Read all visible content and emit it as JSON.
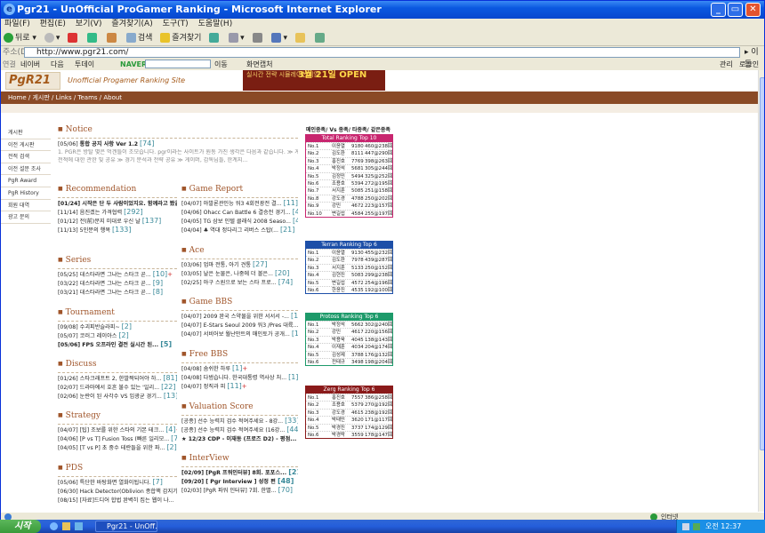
{
  "window": {
    "title": "Pgr21 - UnOfficial ProGamer Ranking - Microsoft Internet Explorer"
  },
  "menu": [
    "파일(F)",
    "편집(E)",
    "보기(V)",
    "즐겨찾기(A)",
    "도구(T)",
    "도움말(H)"
  ],
  "toolbar": {
    "back": "뒤로",
    "search": "검색",
    "favorites": "즐겨찾기"
  },
  "address": {
    "label": "주소(D)",
    "url": "http://www.pgr21.com/",
    "go": "이동"
  },
  "links": {
    "label": "연결",
    "items": [
      "네이버",
      "다음",
      "투데이",
      "NAVER",
      "이동",
      "화면캡처",
      "관리",
      "로그인"
    ]
  },
  "site": {
    "logo": "PgR21",
    "tagline": "Unofficial Progamer Ranking Site",
    "banner_top": "실시간 전략 시뮬레이션게임",
    "banner_main": "3월 21일 OPEN",
    "nav": "Home / 게시판 / Links / Teams / About"
  },
  "sidebar": [
    "게시판",
    "이전 게시판",
    "전적 검색",
    "이전 설문 조사",
    "PgR Award",
    "PgR History",
    "회원 대역",
    "광고 문의"
  ],
  "notice": {
    "title": "Notice",
    "rows": [
      {
        "date": "[05/06]",
        "text": "통합 공지 사항 Ver 1.2",
        "count": "[74]"
      }
    ],
    "desc1": "1. PGR은 방탈 몇은 먹겐틀이 조모습니다. pgr이라는 사이트가 원동 가진 생각은 다음과 같습니다. ≫ 게시마롤의",
    "desc2": "전적에 대한 관한 및 공유 ≫ 경기 분석과 전략 공유 ≫ 게이머, 감독님들, 한계지..."
  },
  "left_sections": [
    {
      "title": "Recommendation",
      "rows": [
        {
          "date": "[01/24]",
          "text": "시작은 단 두 사람이었지요. 함께라고 봤을...",
          "count": "[106]",
          "bold": true
        },
        {
          "date": "[11/14]",
          "text": "음진겠는 가격협력",
          "count": "[292]"
        },
        {
          "date": "[01/12]",
          "text": "전(前)문지 미대로 우신 날",
          "count": "[137]"
        },
        {
          "date": "[11/13]",
          "text": "5인분의 행복",
          "count": "[133]"
        }
      ]
    },
    {
      "title": "Series",
      "rows": [
        {
          "date": "[05/25]",
          "text": "대스타라면 그냐는 스타크 곧...",
          "count": "[10]",
          "plus": true
        },
        {
          "date": "[03/22]",
          "text": "대스타라면 그냐는 스타크 곧...",
          "count": "[9]"
        },
        {
          "date": "[03/21]",
          "text": "대스타라면 그냐는 스타크 곧...",
          "count": "[8]"
        }
      ]
    },
    {
      "title": "Tournament",
      "rows": [
        {
          "date": "[09/08]",
          "text": "수괴피반슬라피~",
          "count": "[2]"
        },
        {
          "date": "[05/07]",
          "text": "코러그 레이아스",
          "count": "[2]"
        },
        {
          "date": "[05/06]",
          "text": "FPS 오프라인 결전 실시간 된...",
          "count": "[5]",
          "bold": true
        }
      ]
    },
    {
      "title": "Discuss",
      "rows": [
        {
          "date": "[01/26]",
          "text": "스타크래프트 2, 한발짝되어야 하...",
          "count": "[81]",
          "plus": true
        },
        {
          "date": "[02/07]",
          "text": "드라마에서 호흔 불수 있는 '일리...",
          "count": "[22]"
        },
        {
          "date": "[02/06]",
          "text": "눈란이 된 사각수 VS 임광균 경기...",
          "count": "[13]"
        }
      ]
    },
    {
      "title": "Strategy",
      "rows": [
        {
          "date": "[04/07]",
          "text": "[팁] 조보를 위한 스타의 기본 테크...",
          "count": "[4]",
          "plus": true
        },
        {
          "date": "[04/06]",
          "text": "[P vs T] Fusion Toss (빠른 일리모...",
          "count": "[7]",
          "plus": true
        },
        {
          "date": "[04/05]",
          "text": "[T vs P] 초 중수 테란들을 위한 파...",
          "count": "[2]"
        }
      ]
    },
    {
      "title": "PDS",
      "rows": [
        {
          "date": "[05/06]",
          "text": "특단한 바탕화면 열화이됩니다.",
          "count": "[7]"
        },
        {
          "date": "[06/30]",
          "text": "Hack Detector(Oblivion 종합핵 감지기...",
          "count": "[17]"
        },
        {
          "date": "[08/15]",
          "text": "[자료]드디어 합법 완벽히 집는 웹이 나...",
          "count": ""
        }
      ]
    }
  ],
  "right_sections": [
    {
      "title": "Game Report",
      "rows": [
        {
          "date": "[04/07]",
          "text": "아발론관인능 워3 4회전광전 결...",
          "count": "[11]",
          "plus": true
        },
        {
          "date": "[04/06]",
          "text": "Ohacc Can Battle 6 결승전 경기...",
          "count": "[4]"
        },
        {
          "date": "[04/05]",
          "text": "TG 삼보 인텔 클래식 2008 Seaso...",
          "count": "[4]"
        },
        {
          "date": "[04/04]",
          "text": "♣ 역대 정다리그 리버스 스탑(...",
          "count": "[21]"
        }
      ]
    },
    {
      "title": "Ace",
      "rows": [
        {
          "date": "[03/06]",
          "text": "업마 전통, 아기 견통",
          "count": "[27]"
        },
        {
          "date": "[03/05]",
          "text": "날은 눈물은, 나중에 더 볼은...",
          "count": "[20]"
        },
        {
          "date": "[02/25]",
          "text": "아구 스원으로 보는 스타 프로...",
          "count": "[74]"
        }
      ]
    },
    {
      "title": "Game BBS",
      "rows": [
        {
          "date": "[04/07]",
          "text": "2009 완국 스약물을 위한 서서서 -...",
          "count": "[16]",
          "plus": true
        },
        {
          "date": "[04/07]",
          "text": "E-Stars Seoul 2009 워3 /Pres 대륙...",
          "count": "[14]",
          "plus": true
        },
        {
          "date": "[04/07]",
          "text": "서비어보 월난만트의 매인토가 공개...",
          "count": "[17]",
          "plus": true
        }
      ]
    },
    {
      "title": "Free BBS",
      "rows": [
        {
          "date": "[04/08]",
          "text": "숨쉬한 하루",
          "count": "[1]",
          "plus": true
        },
        {
          "date": "[04/08]",
          "text": "다범습니다. 한국대통령 역사상 처...",
          "count": "[1]",
          "plus": true
        },
        {
          "date": "[04/07]",
          "text": "정직과 피",
          "count": "[11]",
          "plus": true
        }
      ]
    },
    {
      "title": "Valuation Score",
      "rows": [
        {
          "date": "[공종]",
          "text": "선수 능력치 검수 적여주세요 - 8강...",
          "count": "[33]"
        },
        {
          "date": "[공종]",
          "text": "선수 능력치 검수 적여주세요 (16강...",
          "count": "[44]"
        },
        {
          "date": "★",
          "text": "12/23 CDP - 이재동 (프로즈 D2) - 평점...",
          "count": "[21]",
          "bold": true
        }
      ]
    },
    {
      "title": "InterView",
      "rows": [
        {
          "date": "[02/09]",
          "text": "[PgR 프워인터뷰] 8회. 포포스...",
          "count": "[21]",
          "bold": true
        },
        {
          "date": "[09/20]",
          "text": "[ Pgr Interview ] 성정 편",
          "count": "[48]",
          "bold": true
        },
        {
          "date": "[02/03]",
          "text": "[PgR 파워 인터뷰] 7회. 한별...",
          "count": "[70]"
        }
      ]
    }
  ],
  "ranking_tabs": "메인종족/ Vs 종족/ 타종족/ 같은종족",
  "rankings": [
    {
      "title": "Total Ranking Top 10",
      "color": "#c8266f",
      "rows": [
        [
          "No.1",
          "이윤열",
          "9180",
          "460@238回"
        ],
        [
          "No.2",
          "김도환",
          "8111",
          "447@290回"
        ],
        [
          "No.3",
          "홍진호",
          "7769",
          "398@263回"
        ],
        [
          "No.4",
          "박정석",
          "5681",
          "305@244回"
        ],
        [
          "No.5",
          "김정민",
          "5494",
          "325@252回"
        ],
        [
          "No.6",
          "조용호",
          "5394",
          "272@195回"
        ],
        [
          "No.7",
          "서지훈",
          "5085",
          "251@158回"
        ],
        [
          "No.8",
          "강도경",
          "4788",
          "250@202回"
        ],
        [
          "No.9",
          "강민",
          "4672",
          "223@157回"
        ],
        [
          "No.10",
          "변길섭",
          "4584",
          "255@197回"
        ]
      ]
    },
    {
      "title": "Terran Ranking Top 6",
      "color": "#1d4fa8",
      "rows": [
        [
          "No.1",
          "이윤열",
          "9130",
          "455@232回"
        ],
        [
          "No.2",
          "김도환",
          "7978",
          "439@287回"
        ],
        [
          "No.3",
          "서지훈",
          "5133",
          "250@152回"
        ],
        [
          "No.4",
          "김현진",
          "5083",
          "299@238回"
        ],
        [
          "No.5",
          "변길섭",
          "4572",
          "254@196回"
        ],
        [
          "No.6",
          "한윤진",
          "4535",
          "192@100回"
        ]
      ]
    },
    {
      "title": "Protoss Ranking Top 6",
      "color": "#1d9a6a",
      "rows": [
        [
          "No.1",
          "박정석",
          "5662",
          "302@240回"
        ],
        [
          "No.2",
          "강민",
          "4617",
          "220@156回"
        ],
        [
          "No.3",
          "박용욱",
          "4045",
          "138@143回"
        ],
        [
          "No.4",
          "이재훈",
          "4034",
          "204@174回"
        ],
        [
          "No.5",
          "김성제",
          "3788",
          "176@132回"
        ],
        [
          "No.6",
          "전태규",
          "3498",
          "198@204回"
        ]
      ]
    },
    {
      "title": "Zerg Ranking Top 6",
      "color": "#8a1a1a",
      "rows": [
        [
          "No.1",
          "홍진호",
          "7557",
          "386@258回"
        ],
        [
          "No.2",
          "조용호",
          "5379",
          "270@192回"
        ],
        [
          "No.3",
          "강도경",
          "4615",
          "238@192回"
        ],
        [
          "No.4",
          "박태민",
          "3620",
          "171@117回"
        ],
        [
          "No.5",
          "박경진",
          "3737",
          "174@129回"
        ],
        [
          "No.6",
          "박경락",
          "3559",
          "178@147回"
        ]
      ]
    }
  ],
  "status": {
    "zone": "인터넷"
  },
  "taskbar": {
    "start": "시작",
    "task": "Pgr21 - UnOff...",
    "clock": "오전 12:37"
  }
}
